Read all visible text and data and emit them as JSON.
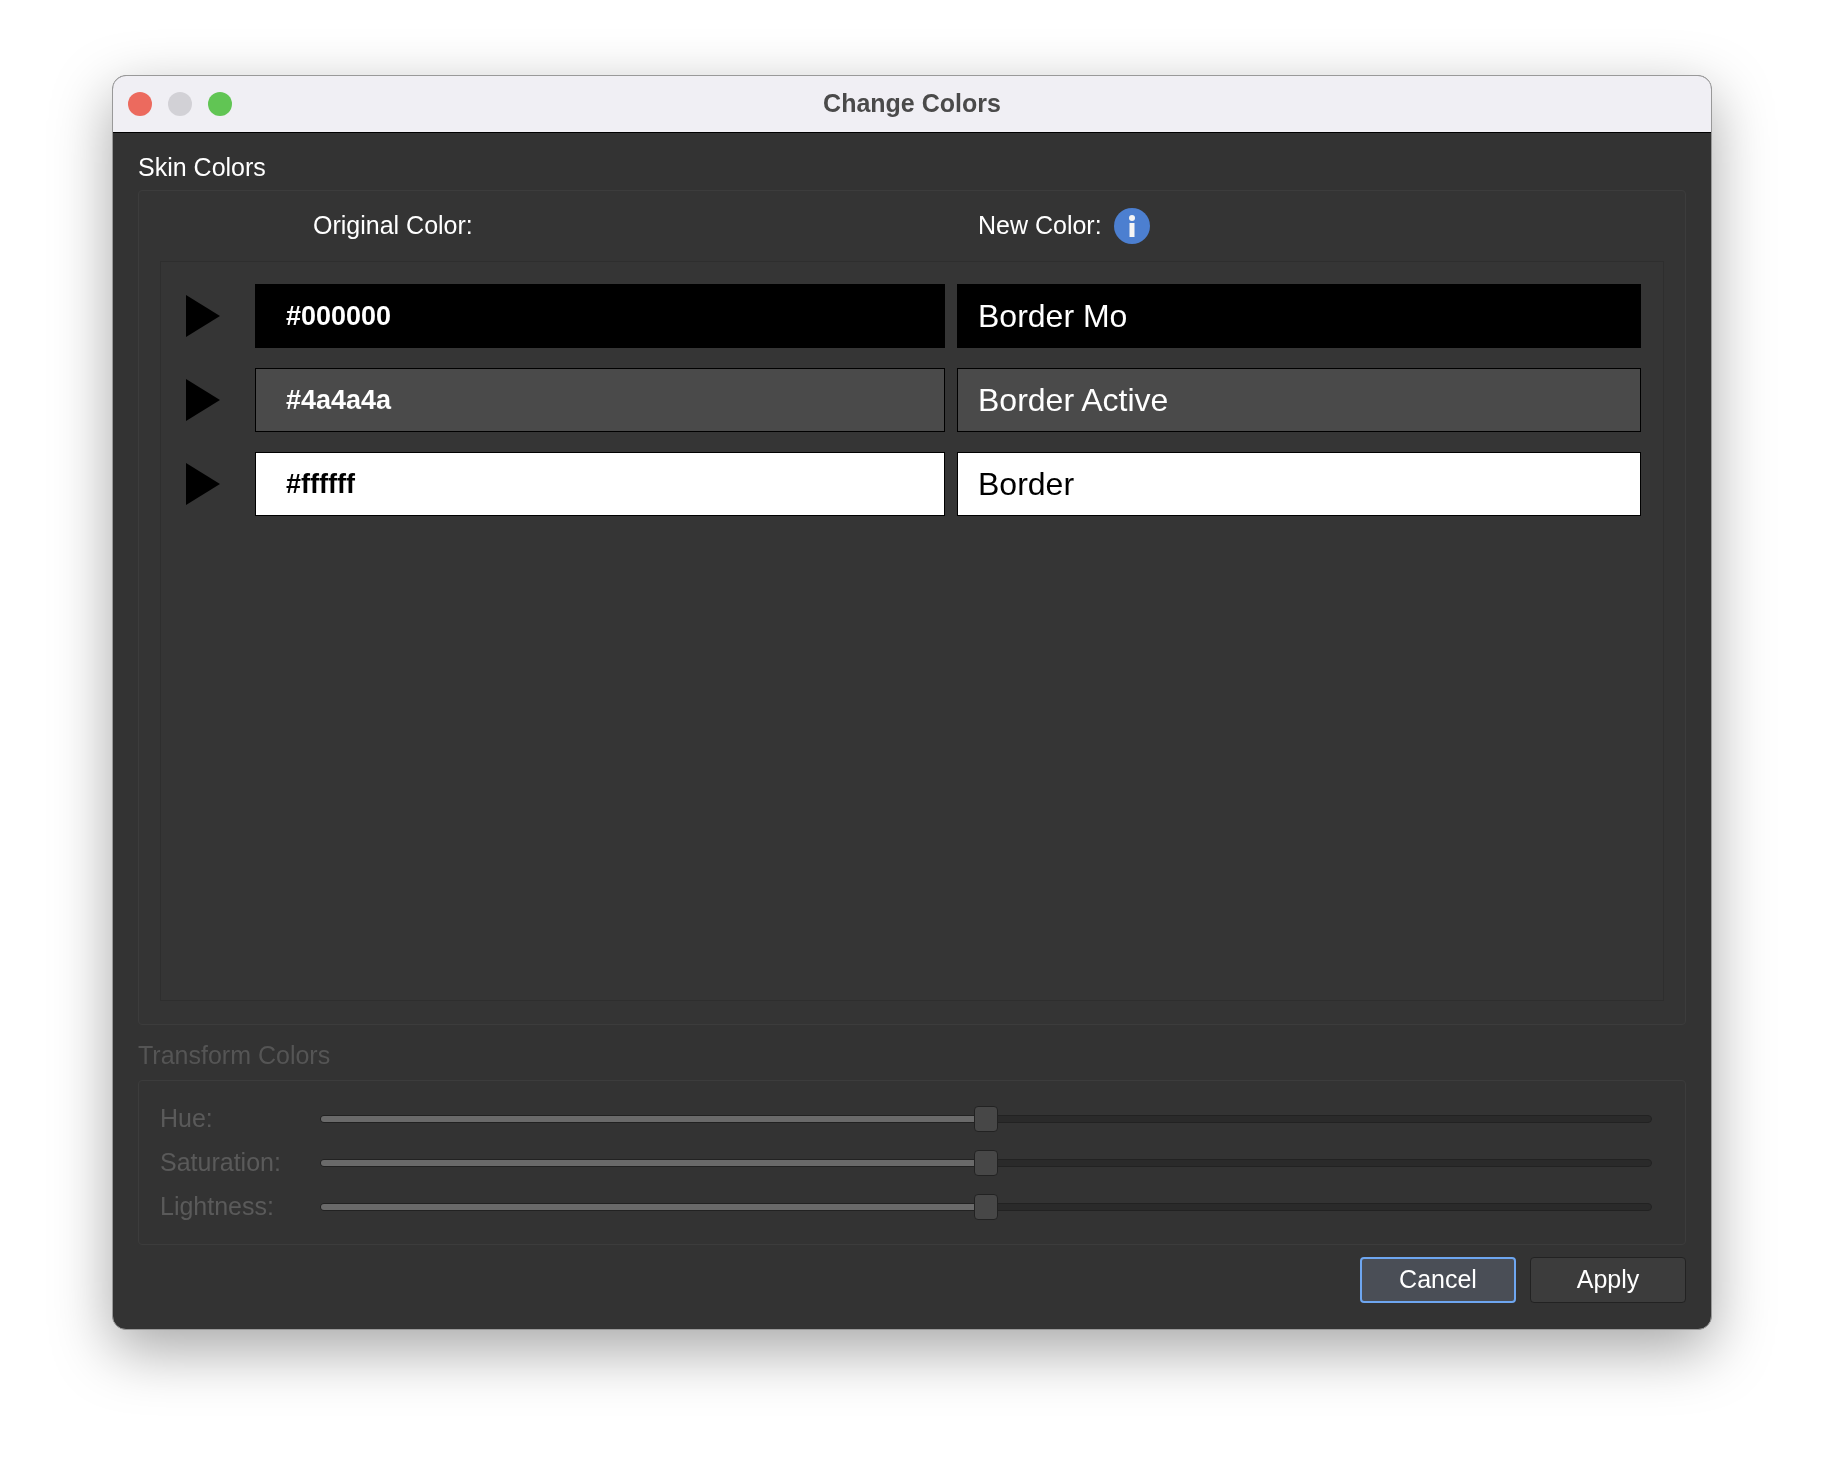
{
  "window": {
    "title": "Change Colors"
  },
  "skin_colors": {
    "title": "Skin Colors",
    "columns": [
      "Original Color:",
      "New Color:"
    ],
    "rows": [
      {
        "original": "#000000",
        "new": "Border Mo",
        "color": "#000000"
      },
      {
        "original": "#4a4a4a",
        "new": "Border Active",
        "color": "#4a4a4a"
      },
      {
        "original": "#ffffff",
        "new": "Border",
        "color": "#ffffff"
      }
    ]
  },
  "transform_colors": {
    "title": "Transform Colors",
    "disabled": true,
    "sliders": [
      {
        "label": "Hue:",
        "level": 0.5
      },
      {
        "label": "Saturation:",
        "level": 0.5
      },
      {
        "label": "Lightness:",
        "level": 0.5
      }
    ]
  },
  "buttons": [
    {
      "label": "Cancel",
      "focused": true
    },
    {
      "label": "Apply",
      "focused": false
    }
  ]
}
